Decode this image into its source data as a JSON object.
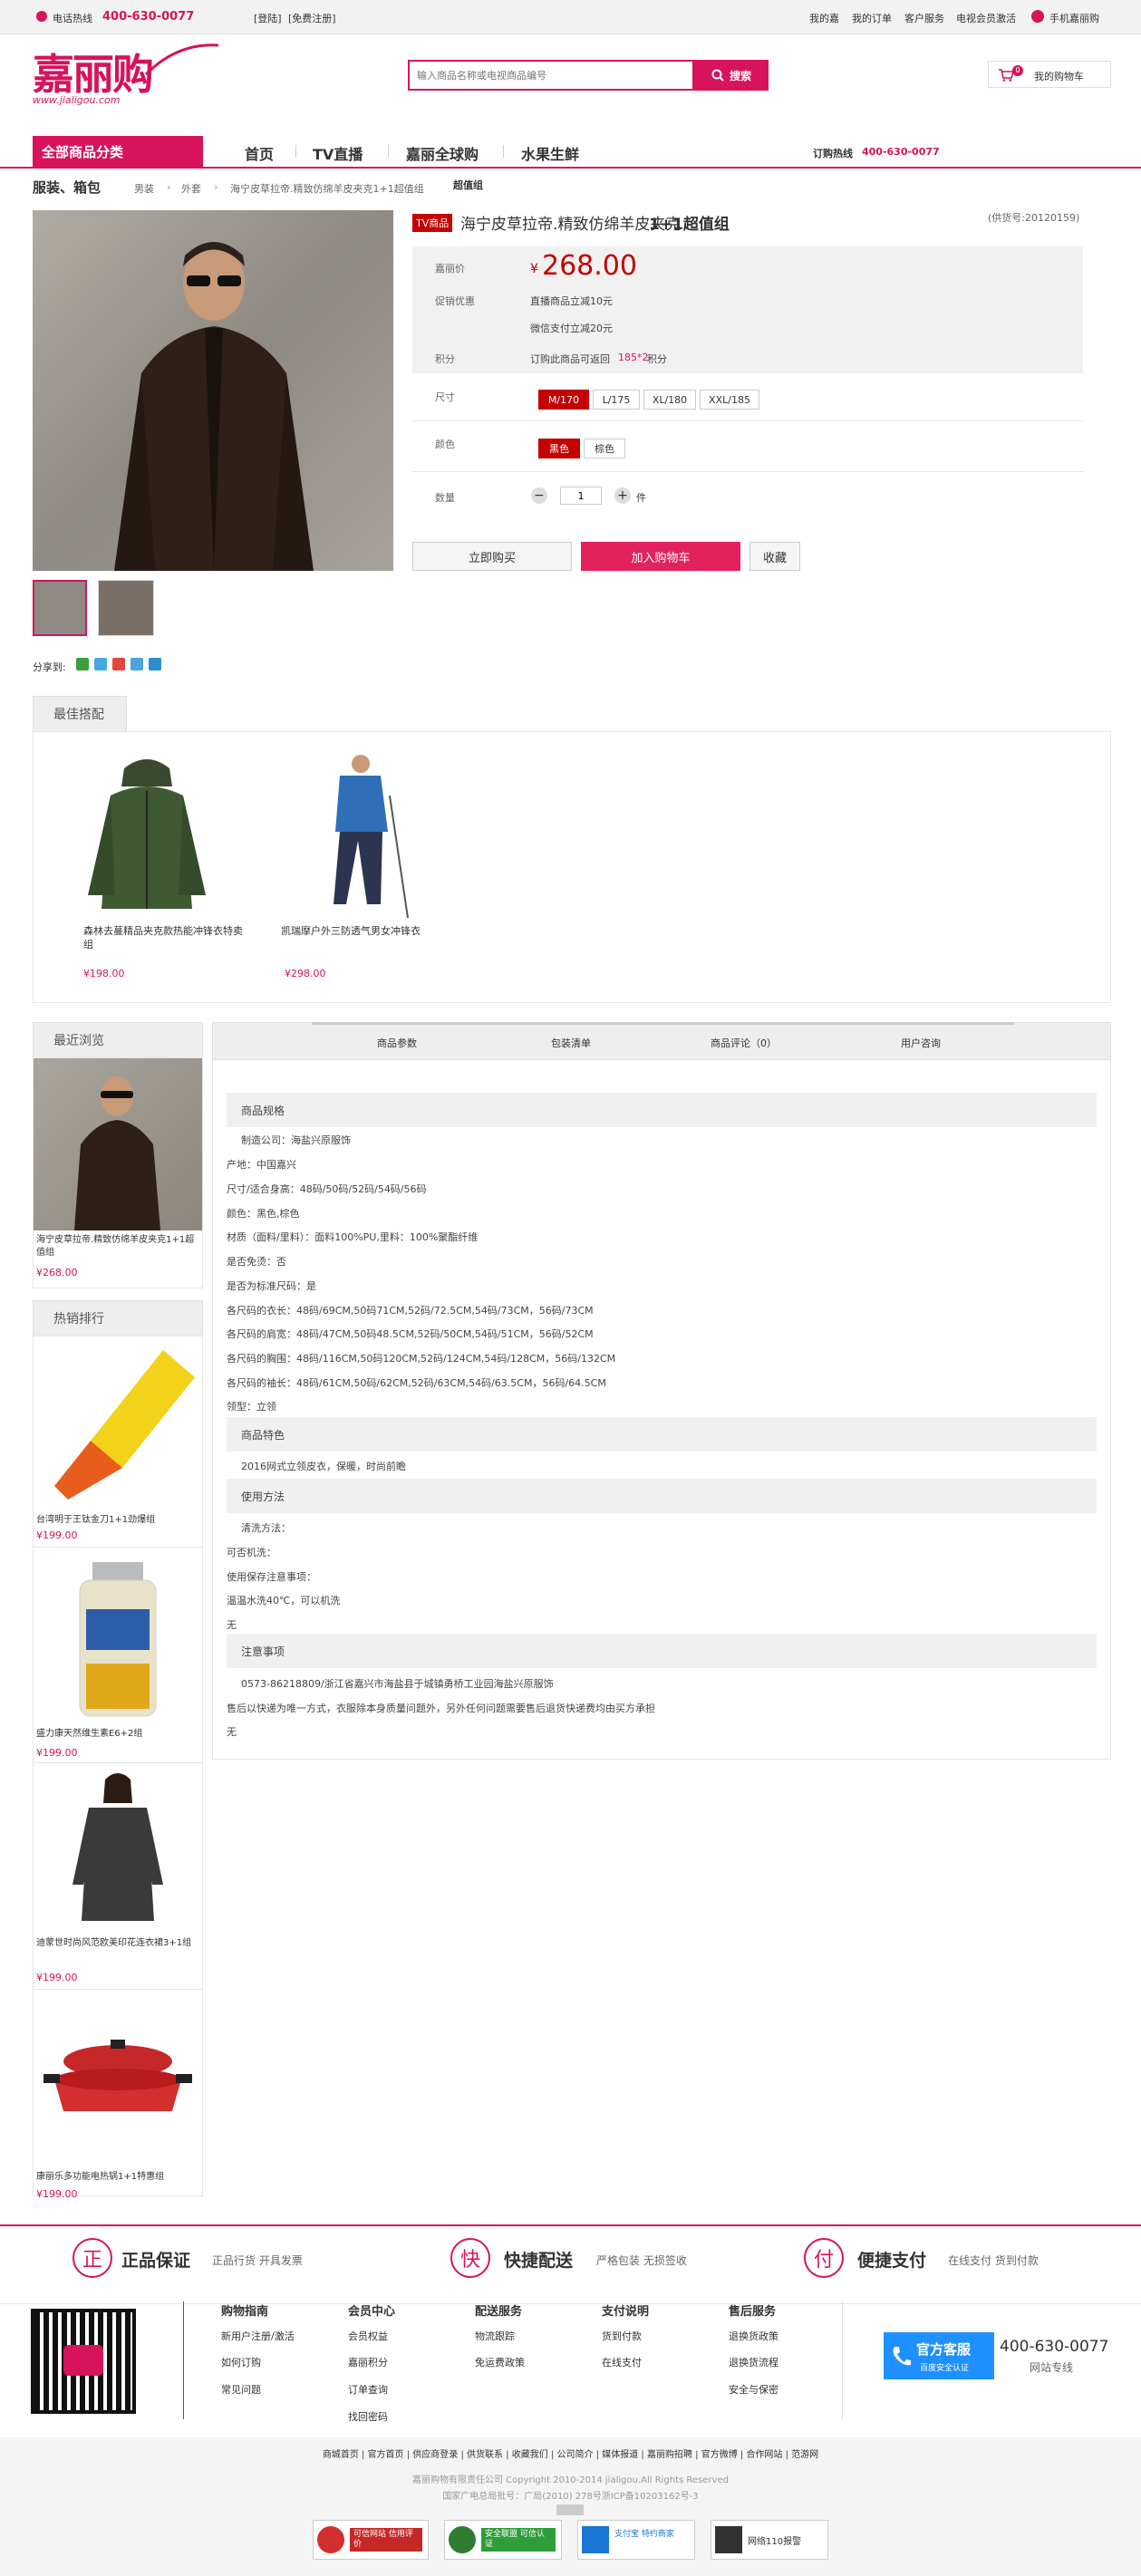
{
  "topbar": {
    "hotline_label": "电话热线",
    "hotline_number": "400-630-0077",
    "welcome": "[登陆]",
    "register": "[免费注册]",
    "links": [
      "我的嘉",
      "我的订单",
      "客户服务",
      "电视会员激活"
    ],
    "mobile": "手机嘉丽购"
  },
  "logo": {
    "text": "嘉丽购",
    "url": "www.jialigou.com"
  },
  "search": {
    "placeholder": "输入商品名称或电视商品编号",
    "button": "搜索"
  },
  "cart": {
    "label": "我的购物车",
    "count": "0"
  },
  "nav": {
    "category": "全部商品分类",
    "items": [
      "首页",
      "TV直播",
      "嘉丽全球购",
      "水果生鲜"
    ],
    "hotline_label": "订购热线",
    "hotline": "400-630-0077"
  },
  "breadcrumb": {
    "title": "服装、箱包",
    "crumbs": [
      "男装",
      "外套",
      "海宁皮草拉帝.精致仿绵羊皮夹克1+1超值组"
    ],
    "current": "超值组"
  },
  "product": {
    "tag": "TV商品",
    "title": "海宁皮草拉帝.精致仿绵羊皮夹克",
    "title_bold": "1+1超值组",
    "code": "(供货号:20120159)",
    "price_label": "嘉丽价",
    "currency": "¥",
    "price": "268.00",
    "promo_label": "促销优惠",
    "promo1": "直播商品立减10元",
    "promo2": "微信支付立减20元",
    "points_label": "积分",
    "points_pre": "订购此商品可返回",
    "points_val": "185*2",
    "points_suf": "积分",
    "size_label": "尺寸",
    "sizes": [
      "M/170",
      "L/175",
      "XL/180",
      "XXL/185"
    ],
    "color_label": "颜色",
    "colors": [
      "黑色",
      "棕色"
    ],
    "qty_label": "数量",
    "qty": "1",
    "qty_unit": "件",
    "buy_now": "立即购买",
    "add_cart": "加入购物车",
    "favorite": "收藏",
    "share_label": "分享到:"
  },
  "best": {
    "tab": "最佳搭配",
    "items": [
      {
        "name": "森林去蔓精品夹克款热能冲锋衣特卖组",
        "price": "¥198.00"
      },
      {
        "name": "凯瑞摩户外三防透气男女冲锋衣",
        "price": "¥298.00"
      }
    ]
  },
  "recent": {
    "tab": "最近浏览",
    "item": {
      "name": "海宁皮草拉帝.精致仿绵羊皮夹克1+1超值组",
      "price": "¥268.00"
    }
  },
  "hot": {
    "tab": "热销排行",
    "items": [
      {
        "name": "台湾明于王钛金刀1+1劲爆组",
        "price": "¥199.00"
      },
      {
        "name": "盛力康天然维生素E6+2组",
        "price": "¥199.00"
      },
      {
        "name": "迪蒙世时尚风范欧美印花连衣裙3+1组",
        "price": "¥199.00"
      },
      {
        "name": "康丽乐多功能电热锅1+1特惠组",
        "price": "¥199.00"
      }
    ]
  },
  "detail": {
    "tabs": [
      "商品参数",
      "包装清单",
      "商品评论（0）",
      "用户咨询"
    ],
    "sec1": "商品规格",
    "specs": [
      "制造公司：海盐兴原服饰",
      "产地：中国嘉兴",
      "尺寸/适合身高：48码/50码/52码/54码/56码",
      "颜色：黑色,棕色",
      "材质（面料/里料）：面料100%PU,里料：100%聚酯纤维",
      "是否免烫：否",
      "是否为标准尺码：是",
      "各尺码的衣长：48码/69CM,50码71CM,52码/72.5CM,54码/73CM，56码/73CM",
      "各尺码的肩宽：48码/47CM,50码48.5CM,52码/50CM,54码/51CM，56码/52CM",
      "各尺码的胸围：48码/116CM,50码120CM,52码/124CM,54码/128CM，56码/132CM",
      "各尺码的袖长：48码/61CM,50码/62CM,52码/63CM,54码/63.5CM，56码/64.5CM",
      "领型：立领"
    ],
    "sec2": "商品特色",
    "feature": "2016网式立领皮衣，保暖，时尚前瞻",
    "sec3": "使用方法",
    "usage": [
      "清洗方法：",
      "可否机洗：",
      "使用保存注意事项：",
      "温温水洗40℃，可以机洗",
      "无"
    ],
    "sec4": "注意事项",
    "notes": [
      "0573-86218809/浙江省嘉兴市海盐县于城镇勇桥工业园海盐兴原服饰",
      "售后以快递为唯一方式，衣服除本身质量问题外，另外任何问题需要售后退货快递费均由买方承担",
      "无"
    ]
  },
  "guarantee": [
    {
      "icon": "正",
      "title": "正品保证",
      "sub": "正品行货 开具发票"
    },
    {
      "icon": "快",
      "title": "快捷配送",
      "sub": "严格包装 无损签收"
    },
    {
      "icon": "付",
      "title": "便捷支付",
      "sub": "在线支付 货到付款"
    }
  ],
  "footer_cols": [
    {
      "title": "购物指南",
      "links": [
        "新用户注册/激活",
        "如何订购",
        "常见问题"
      ]
    },
    {
      "title": "会员中心",
      "links": [
        "会员权益",
        "嘉丽积分",
        "订单查询",
        "找回密码"
      ]
    },
    {
      "title": "配送服务",
      "links": [
        "物流跟踪",
        "免运费政策"
      ]
    },
    {
      "title": "支付说明",
      "links": [
        "货到付款",
        "在线支付"
      ]
    },
    {
      "title": "售后服务",
      "links": [
        "退换货政策",
        "退换货流程",
        "安全与保密"
      ]
    }
  ],
  "service": {
    "title": "官方客服",
    "sub": "百度安全认证",
    "phone": "400-630-0077",
    "phone_label": "网站专线"
  },
  "bottom_links": [
    "商城首页",
    "官方首页",
    "供应商登录",
    "供货联系",
    "收藏我们",
    "公司简介",
    "媒体报道",
    "嘉丽购招聘",
    "官方微博",
    "合作网站",
    "范游网"
  ],
  "copyright": "嘉丽购物有限责任公司 Copyright 2010-2014 jialigou.All Rights Reserved",
  "license": "国家广电总局批号：广局(2010) 278号浙ICP备10203162号-3",
  "badges": [
    "可信网站 信用评价",
    "安全联盟 可信认证",
    "支付宝 特约商家",
    "网络110报警"
  ],
  "colors": {
    "brand": "#d6135c",
    "price": "#c40000"
  }
}
